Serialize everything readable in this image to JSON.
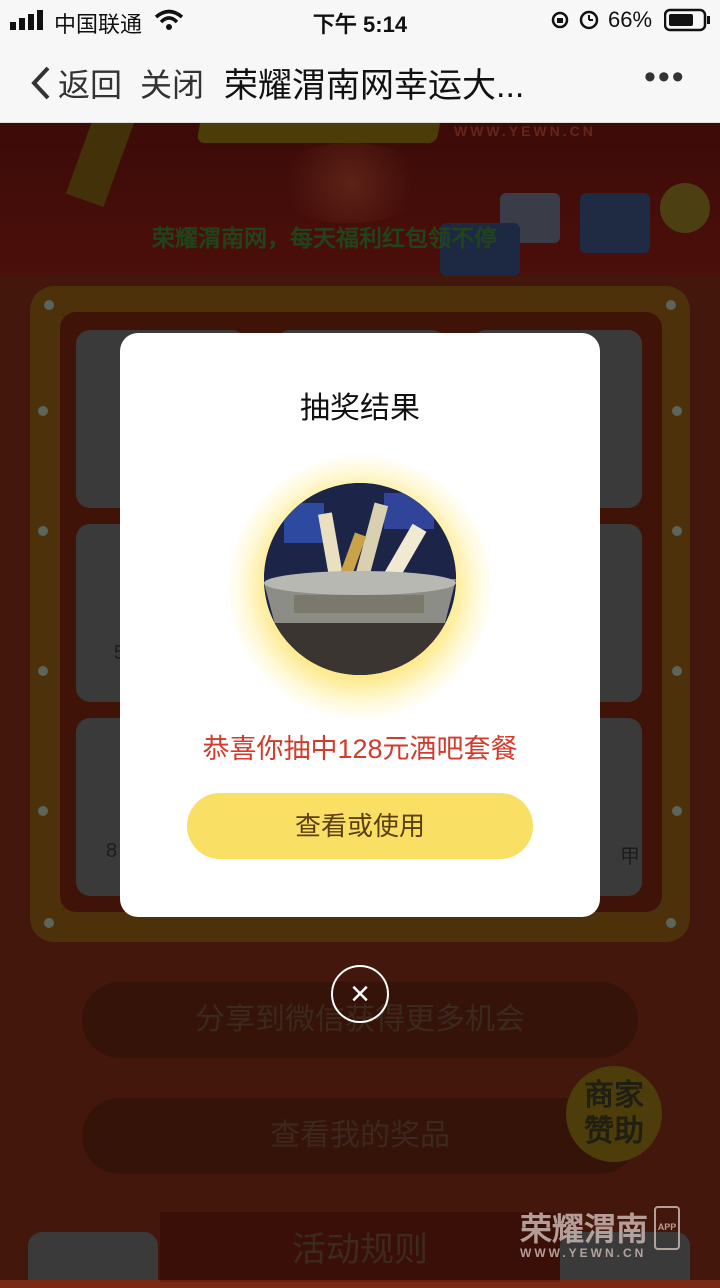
{
  "status_bar": {
    "carrier": "中国联通",
    "time": "下午 5:14",
    "battery": "66%"
  },
  "nav": {
    "back": "返回",
    "close": "关闭",
    "title": "荣耀渭南网幸运大...",
    "more": "•••"
  },
  "banner": {
    "url": "WWW.YEWN.CN",
    "slogan": "荣耀渭南网，每天福利红包领不停"
  },
  "board": {
    "partial_left_1": "5",
    "partial_left_2": "8",
    "partial_right_2": "甲"
  },
  "background_buttons": {
    "share": "分享到微信获得更多机会",
    "my_prizes": "查看我的奖品",
    "rules": "活动规则"
  },
  "sponsor": {
    "line1": "商家",
    "line2": "赞助"
  },
  "watermark": {
    "brand": "荣耀渭南",
    "url": "WWW.YEWN.CN",
    "app": "APP"
  },
  "modal": {
    "title": "抽奖结果",
    "result": "恭喜你抽中128元酒吧套餐",
    "action": "查看或使用",
    "close": "×"
  }
}
